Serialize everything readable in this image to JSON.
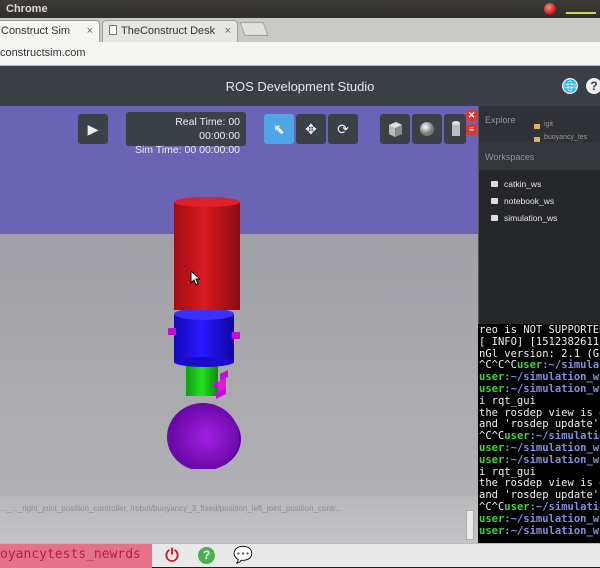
{
  "os": {
    "title": "Chrome"
  },
  "tabs": [
    {
      "label": "Construct Sim",
      "close": "×"
    },
    {
      "label": "TheConstruct Desk",
      "close": "×"
    }
  ],
  "address": {
    "url": "constructsim.com"
  },
  "header": {
    "title": "ROS Development Studio",
    "globe_icon": "🌐",
    "help_icon": "?"
  },
  "viewport": {
    "play_icon": "▶",
    "time": {
      "real": "Real Time: 00 00:00:00",
      "sim": "Sim Time: 00 00:00:00"
    },
    "tools": {
      "select_icon": "⬉",
      "move_icon": "✥",
      "rotate_icon": "⟳"
    },
    "shapes": {
      "box_icon": "cube",
      "sphere_icon": "sphere",
      "cylinder_icon": "cylinder"
    },
    "log_text": "..._..._right_joint_position_controller, /robot/buoyancy_3_fixed/position_left_joint_position_contr...",
    "colors": {
      "sky": "#6b63b6",
      "ground": "#a6a6aa",
      "top_cylinder": "#c0141e",
      "mid_cylinder": "#1f10e0",
      "neck": "#18c418",
      "sphere": "#8a10c8",
      "marker": "#c010d8"
    }
  },
  "explore": {
    "title": "Explore",
    "item": "igit",
    "item2": "buoyancy_tes"
  },
  "workspaces": {
    "title": "Workspaces",
    "items": [
      "catkin_ws",
      "notebook_ws",
      "simulation_ws"
    ]
  },
  "terminal": {
    "lines": [
      {
        "text": "reo is NOT SUPPORTED"
      },
      {
        "text": "[ INFO] [1512382611"
      },
      {
        "text": "nGl version: 2.1 (G"
      },
      {
        "pre": "^C^C^C",
        "prompt": "user",
        "path": ":~/simula"
      },
      {
        "prompt": "user",
        "path": ":~/simulation_w"
      },
      {
        "prompt": "user",
        "path": ":~/simulation_w"
      },
      {
        "text": "i rqt_gui"
      },
      {
        "text": "the rosdep view is e"
      },
      {
        "text": "and 'rosdep update'"
      },
      {
        "pre": "^C^C",
        "prompt": "user",
        "path": ":~/simulatio"
      },
      {
        "prompt": "user",
        "path": ":~/simulation_w"
      },
      {
        "prompt": "user",
        "path": ":~/simulation_w"
      },
      {
        "text": "i rqt_gui"
      },
      {
        "text": "the rosdep view is e"
      },
      {
        "text": "and 'rosdep update'"
      },
      {
        "pre": "^C^C",
        "prompt": "user",
        "path": ":~/simulatio"
      },
      {
        "prompt": "user",
        "path": ":~/simulation_w"
      },
      {
        "prompt": "user",
        "path": ":~/simulation_w"
      }
    ]
  },
  "status": {
    "project": "oyancytests_newrds",
    "power_icon": "⏻",
    "help_icon": "?",
    "chat_icon": "💬"
  },
  "panel_icons": {
    "close": "✕",
    "list": "≡"
  }
}
